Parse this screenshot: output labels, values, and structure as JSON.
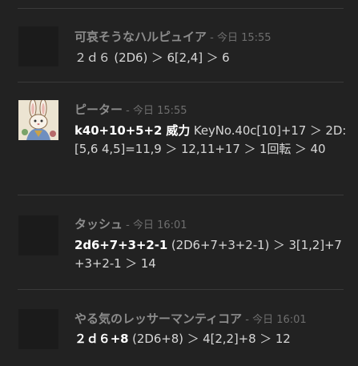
{
  "messages": [
    {
      "name": "可哀そうなハルピュイア",
      "separator": " - ",
      "time": "今日 15:55",
      "bold": "",
      "text": "２ｄ６ (2D6) ＞ 6[2,4] ＞ 6"
    },
    {
      "name": "ピーター",
      "separator": " - ",
      "time": "今日 15:55",
      "bold": "k40+10+5+2 威力",
      "text": " KeyNo.40c[10]+17 ＞ 2D:[5,6 4,5]=11,9 ＞ 12,11+17 ＞ 1回転 ＞ 40"
    },
    {
      "name": "タッシュ",
      "separator": " - ",
      "time": "今日 16:01",
      "bold": "2d6+7+3+2-1",
      "text": " (2D6+7+3+2-1) ＞ 3[1,2]+7+3+2-1 ＞ 14"
    },
    {
      "name": "やる気のレッサーマンティコア",
      "separator": " - ",
      "time": "今日 16:01",
      "bold": "２ｄ６+8",
      "text": " (2D6+8) ＞ 4[2,2]+8 ＞ 12"
    }
  ],
  "icons": {
    "peter_avatar": "rabbit-avatar-icon"
  }
}
